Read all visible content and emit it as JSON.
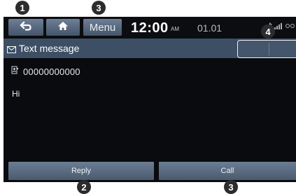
{
  "statusbar": {
    "back_icon": "back-arrow-icon",
    "home_icon": "home-icon",
    "menu_label": "Menu",
    "time": "12:00",
    "ampm": "AM",
    "date": "01.01"
  },
  "titlebar": {
    "icon": "envelope-icon",
    "title": "Text message"
  },
  "message": {
    "contact_icon": "contact-icon",
    "sender_number": "00000000000",
    "body": "Hi"
  },
  "actions": {
    "reply_label": "Reply",
    "call_label": "Call"
  },
  "callouts": {
    "back": "1",
    "menu": "3",
    "top_right": "4",
    "reply": "2",
    "call": "3"
  },
  "colors": {
    "screen_bg": "#0a0b0e",
    "titlebar_bg": "#3d4f64",
    "button_bg": "#5b6d83",
    "callout_bg": "#2c2c2c"
  }
}
